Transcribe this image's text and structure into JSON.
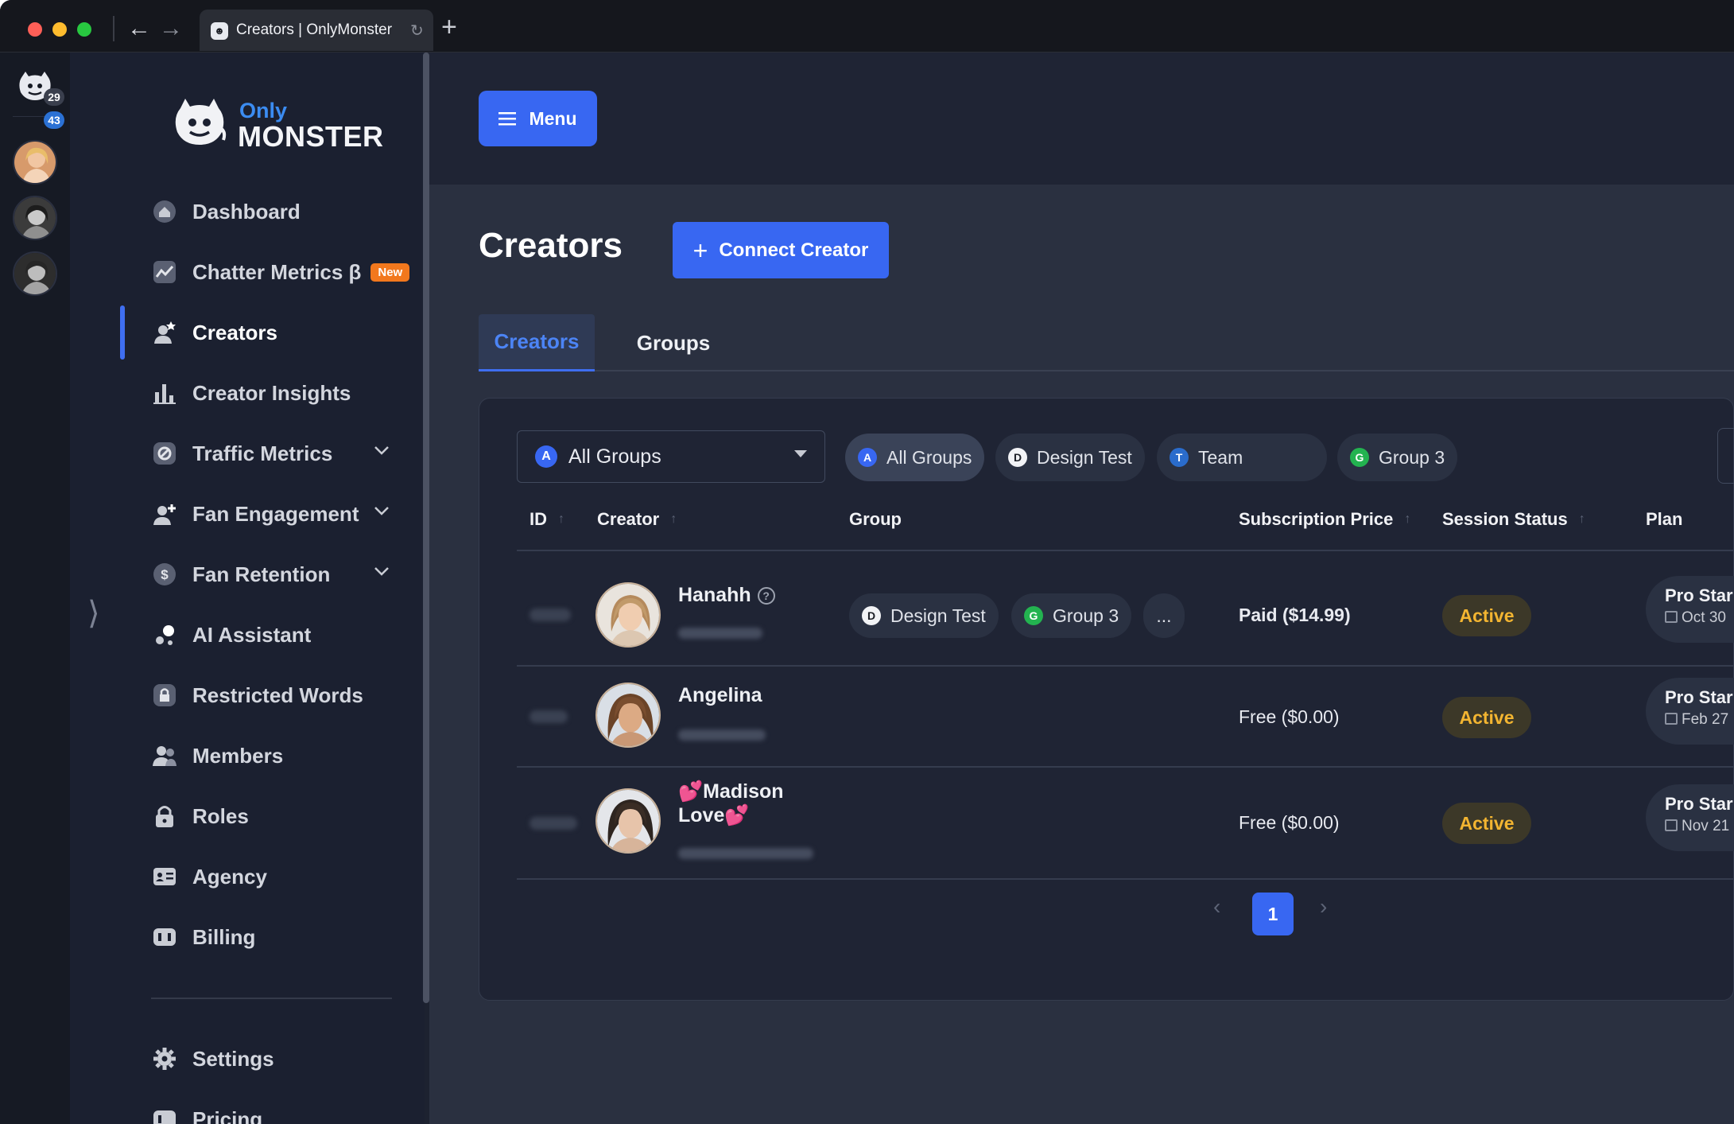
{
  "browser": {
    "tab_title": "Creators | OnlyMonster",
    "back_glyph": "←",
    "forward_glyph": "→",
    "reload_glyph": "↻",
    "new_tab_glyph": "+"
  },
  "rail": {
    "badge_unread": "29",
    "badge_messages": "43"
  },
  "brand": {
    "line1": "Only",
    "line2": "MONSTER"
  },
  "sidebar": {
    "items": [
      {
        "label": "Dashboard",
        "icon": "home-icon"
      },
      {
        "label": "Chatter Metrics β",
        "icon": "chart-line-icon",
        "badge": "New"
      },
      {
        "label": "Creators",
        "icon": "creator-star-icon",
        "active": true
      },
      {
        "label": "Creator Insights",
        "icon": "bar-chart-icon"
      },
      {
        "label": "Traffic Metrics",
        "icon": "link-icon",
        "expandable": true
      },
      {
        "label": "Fan Engagement",
        "icon": "user-plus-icon",
        "expandable": true
      },
      {
        "label": "Fan Retention",
        "icon": "dollar-icon",
        "expandable": true
      },
      {
        "label": "AI Assistant",
        "icon": "ai-icon"
      },
      {
        "label": "Restricted Words",
        "icon": "lock-icon"
      },
      {
        "label": "Members",
        "icon": "users-icon"
      },
      {
        "label": "Roles",
        "icon": "padlock-icon"
      },
      {
        "label": "Agency",
        "icon": "id-card-icon"
      },
      {
        "label": "Billing",
        "icon": "billing-icon"
      },
      {
        "label": "Settings",
        "icon": "gear-icon"
      },
      {
        "label": "Pricing",
        "icon": "pricing-icon"
      }
    ],
    "collapse_glyph": "⟩"
  },
  "header": {
    "menu_label": "Menu"
  },
  "page": {
    "title": "Creators",
    "connect_label": "Connect Creator",
    "tabs": [
      "Creators",
      "Groups"
    ]
  },
  "filters": {
    "select": {
      "letter": "A",
      "value": "All Groups"
    },
    "chips": [
      {
        "letter": "A",
        "label": "All Groups",
        "color": "#3867f2"
      },
      {
        "letter": "D",
        "label": "Design Test",
        "color": "#f2f3f6"
      },
      {
        "letter": "T",
        "label": "Team",
        "color": "#2a6ccc"
      },
      {
        "letter": "G",
        "label": "Group 3",
        "color": "#23b350"
      }
    ]
  },
  "table": {
    "columns": [
      "ID",
      "Creator",
      "Group",
      "Subscription Price",
      "Session Status",
      "Plan"
    ],
    "sort_glyph": "↑",
    "rows": [
      {
        "name": "Hanahh",
        "help": "?",
        "groups": [
          {
            "letter": "D",
            "label": "Design Test"
          },
          {
            "letter": "G",
            "label": "Group 3"
          }
        ],
        "more": "...",
        "price": "Paid ($14.99)",
        "status": "Active",
        "plan": "Pro Star",
        "plan_date": "Oct 30"
      },
      {
        "name": "Angelina",
        "price": "Free ($0.00)",
        "status": "Active",
        "plan": "Pro Star",
        "plan_date": "Feb 27"
      },
      {
        "name_line1": "💕Madison",
        "name_line2": "Love💕",
        "price": "Free ($0.00)",
        "status": "Active",
        "plan": "Pro Star",
        "plan_date": "Nov 21"
      }
    ]
  },
  "pagination": {
    "current": "1",
    "prev": "‹",
    "next": "›"
  },
  "colors": {
    "accent": "#3867f2",
    "status_active": "#f3b531",
    "badge_new": "#f2781d"
  }
}
